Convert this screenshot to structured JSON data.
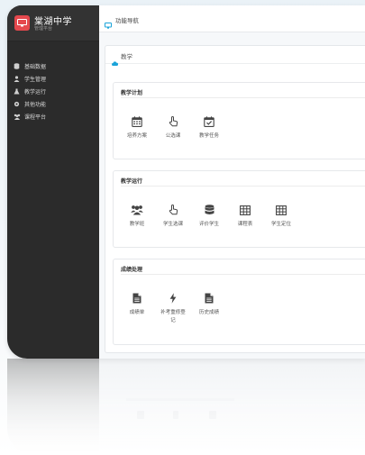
{
  "brand": {
    "title": "棠湖中学",
    "subtitle": "管理平台",
    "accent_color": "#e5484d",
    "logo_icon": "monitor-icon"
  },
  "sidebar": {
    "background": "#2b2b2b",
    "items": [
      {
        "label": "基础数据",
        "icon": "database-icon"
      },
      {
        "label": "学生管理",
        "icon": "user-icon"
      },
      {
        "label": "教学运行",
        "icon": "flask-icon"
      },
      {
        "label": "其他功能",
        "icon": "gear-icon"
      },
      {
        "label": "课程平台",
        "icon": "users-icon"
      }
    ]
  },
  "topbar": {
    "label": "功能导航",
    "icon": "monitor-icon",
    "icon_color": "#1aa3d9"
  },
  "panel": {
    "title": "教学",
    "icon": "cloud-icon",
    "icon_color": "#1aa3d9"
  },
  "sections": [
    {
      "title": "教学计划",
      "items": [
        {
          "label": "培养方案",
          "icon": "calendar-icon"
        },
        {
          "label": "公选课",
          "icon": "hand-pointer-icon"
        },
        {
          "label": "教学任务",
          "icon": "calendar-check-icon"
        }
      ]
    },
    {
      "title": "教学运行",
      "items": [
        {
          "label": "教学班",
          "icon": "users-icon"
        },
        {
          "label": "学生选课",
          "icon": "hand-pointer-icon"
        },
        {
          "label": "评价学生",
          "icon": "database-icon"
        },
        {
          "label": "课程表",
          "icon": "table-icon"
        },
        {
          "label": "学生定位",
          "icon": "table-icon"
        }
      ]
    },
    {
      "title": "成绩处理",
      "items": [
        {
          "label": "成绩单",
          "icon": "file-text-icon"
        },
        {
          "label": "补考重修登记",
          "icon": "bolt-icon"
        },
        {
          "label": "历史成绩",
          "icon": "file-text-icon"
        }
      ]
    }
  ]
}
